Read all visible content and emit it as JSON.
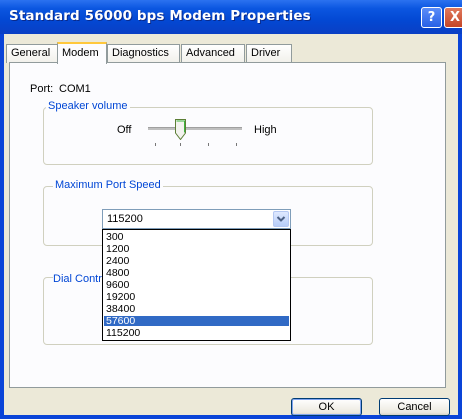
{
  "window": {
    "title": "Standard 56000 bps Modem Properties",
    "help_symbol": "?",
    "close_symbol": "X"
  },
  "tabs": [
    {
      "label": "General",
      "active": false
    },
    {
      "label": "Modem",
      "active": true
    },
    {
      "label": "Diagnostics",
      "active": false
    },
    {
      "label": "Advanced",
      "active": false
    },
    {
      "label": "Driver",
      "active": false
    }
  ],
  "port": {
    "label": "Port:",
    "value": "COM1"
  },
  "speaker_volume": {
    "group_title": "Speaker volume",
    "min_label": "Off",
    "max_label": "High",
    "level_fraction": 0.33
  },
  "max_port_speed": {
    "group_title": "Maximum Port Speed",
    "selected_value": "115200",
    "options": [
      "300",
      "1200",
      "2400",
      "4800",
      "9600",
      "19200",
      "38400",
      "57600",
      "115200"
    ],
    "highlighted_option": "57600"
  },
  "dial_control": {
    "group_title": "Dial Control"
  },
  "buttons": {
    "ok": "OK",
    "cancel": "Cancel"
  },
  "colors": {
    "titlebar": "#0a44d8",
    "group_title_text": "#0046d5",
    "selection": "#316ac5",
    "active_tab_accent": "#ffc83c"
  }
}
